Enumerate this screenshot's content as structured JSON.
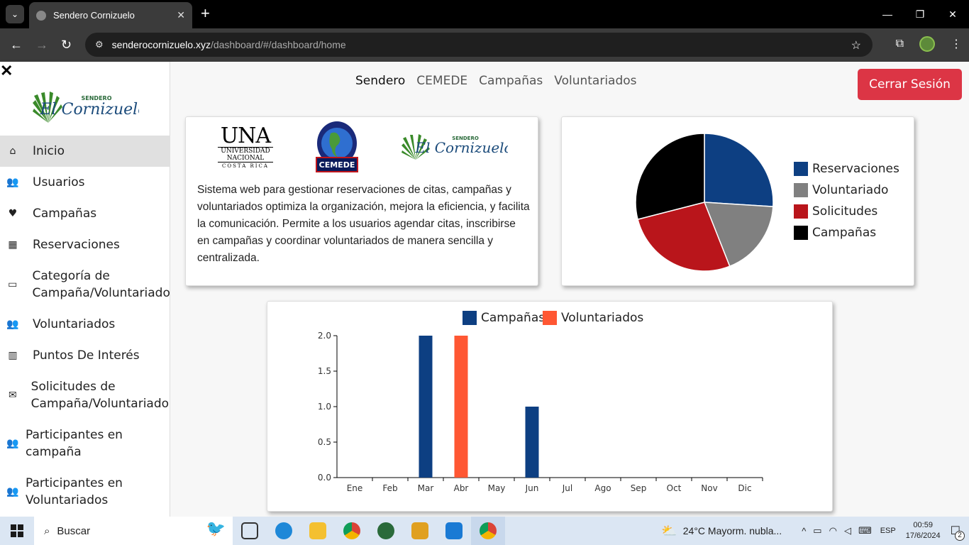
{
  "browser": {
    "tab_title": "Sendero Cornizuelo",
    "url_host": "senderocornizuelo.xyz",
    "url_path": "/dashboard/#/dashboard/home"
  },
  "sidebar": {
    "items": [
      {
        "label": "Inicio",
        "icon": "home-icon"
      },
      {
        "label": "Usuarios",
        "icon": "users-icon"
      },
      {
        "label": "Campañas",
        "icon": "hand-heart-icon"
      },
      {
        "label": "Reservaciones",
        "icon": "calendar-icon"
      },
      {
        "label": "Categoría de Campaña/Voluntariado",
        "icon": "sign-icon"
      },
      {
        "label": "Voluntariados",
        "icon": "users-icon"
      },
      {
        "label": "Puntos De Interés",
        "icon": "map-icon"
      },
      {
        "label": "Solicitudes de Campaña/Voluntariado",
        "icon": "envelope-icon"
      },
      {
        "label": "Participantes en campaña",
        "icon": "users-green-icon"
      },
      {
        "label": "Participantes en Voluntariados",
        "icon": "users-green-icon"
      }
    ]
  },
  "topnav": {
    "links": [
      "Sendero",
      "CEMEDE",
      "Campañas",
      "Voluntariados"
    ],
    "logout_label": "Cerrar Sesión"
  },
  "info_card": {
    "una_title": "UNA",
    "una_sub1": "UNIVERSIDAD",
    "una_sub2": "NACIONAL",
    "una_sub3": "COSTA RICA",
    "cemede_label": "CEMEDE",
    "logo_sendero": "SENDERO",
    "logo_name": "El Cornizuelo",
    "description": "Sistema web para gestionar reservaciones de citas, campañas y voluntariados optimiza la organización, mejora la eficiencia, y facilita la comunicación. Permite a los usuarios agendar citas, inscribirse en campañas y coordinar voluntariados de manera sencilla y centralizada."
  },
  "sidebar_logo": {
    "top": "SENDERO",
    "name": "El Cornizuelo"
  },
  "colors": {
    "blue": "#0d3f82",
    "gray": "#808080",
    "red": "#b9151b",
    "black": "#000000",
    "orange": "#ff5733",
    "logout": "#dc3545"
  },
  "chart_data": [
    {
      "type": "pie",
      "labels": [
        "Reservaciones",
        "Voluntariado",
        "Solicitudes",
        "Campañas"
      ],
      "values": [
        26,
        18,
        27,
        29
      ],
      "colors": [
        "#0d3f82",
        "#808080",
        "#b9151b",
        "#000000"
      ],
      "legend": "right"
    },
    {
      "type": "bar",
      "categories": [
        "Ene",
        "Feb",
        "Mar",
        "Abr",
        "May",
        "Jun",
        "Jul",
        "Ago",
        "Sep",
        "Oct",
        "Nov",
        "Dic"
      ],
      "series": [
        {
          "name": "Campañas",
          "color": "#0d3f82",
          "values": [
            0,
            0,
            2,
            0,
            0,
            1,
            0,
            0,
            0,
            0,
            0,
            0
          ]
        },
        {
          "name": "Voluntariados",
          "color": "#ff5733",
          "values": [
            0,
            0,
            0,
            2,
            0,
            0,
            0,
            0,
            0,
            0,
            0,
            0
          ]
        }
      ],
      "yticks": [
        "0.0",
        "0.5",
        "1.0",
        "1.5",
        "2.0"
      ],
      "ylim": [
        0,
        2
      ],
      "legend": "top"
    }
  ],
  "taskbar": {
    "search_label": "Buscar",
    "weather": "24°C  Mayorm. nubla...",
    "lang": "ESP",
    "time": "00:59",
    "date": "17/6/2024",
    "notifications": "2"
  }
}
